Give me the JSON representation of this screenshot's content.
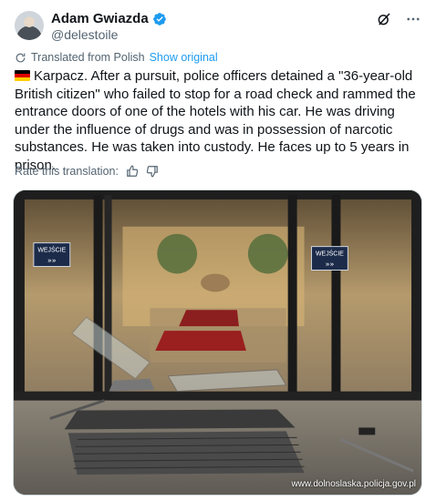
{
  "author": {
    "display_name": "Adam Gwiazda",
    "handle": "@delestoile",
    "verified": true
  },
  "header_icons": [
    "grok-icon",
    "more-icon"
  ],
  "translation": {
    "label": "Translated from Polish",
    "show_original": "Show original"
  },
  "tweet": {
    "flag": "germany-flag",
    "text": "Karpacz. After a pursuit, police officers detained a \"36-year-old British citizen\" who failed to stop for a road check and rammed the entrance doors of one of the hotels with his car. He was driving under the influence of drugs and was in possession of narcotic substances. He was taken into custody. He faces up to 5 years in prison."
  },
  "rate": {
    "label": "Rate this translation:"
  },
  "photo": {
    "sign_left": "WEJŚCIE",
    "sign_right": "WEJŚCIE",
    "watermark": "www.dolnoslaska.policja.gov.pl"
  },
  "colors": {
    "accent": "#1d9bf0",
    "secondary_text": "#536471",
    "primary_text": "#0f1419"
  }
}
